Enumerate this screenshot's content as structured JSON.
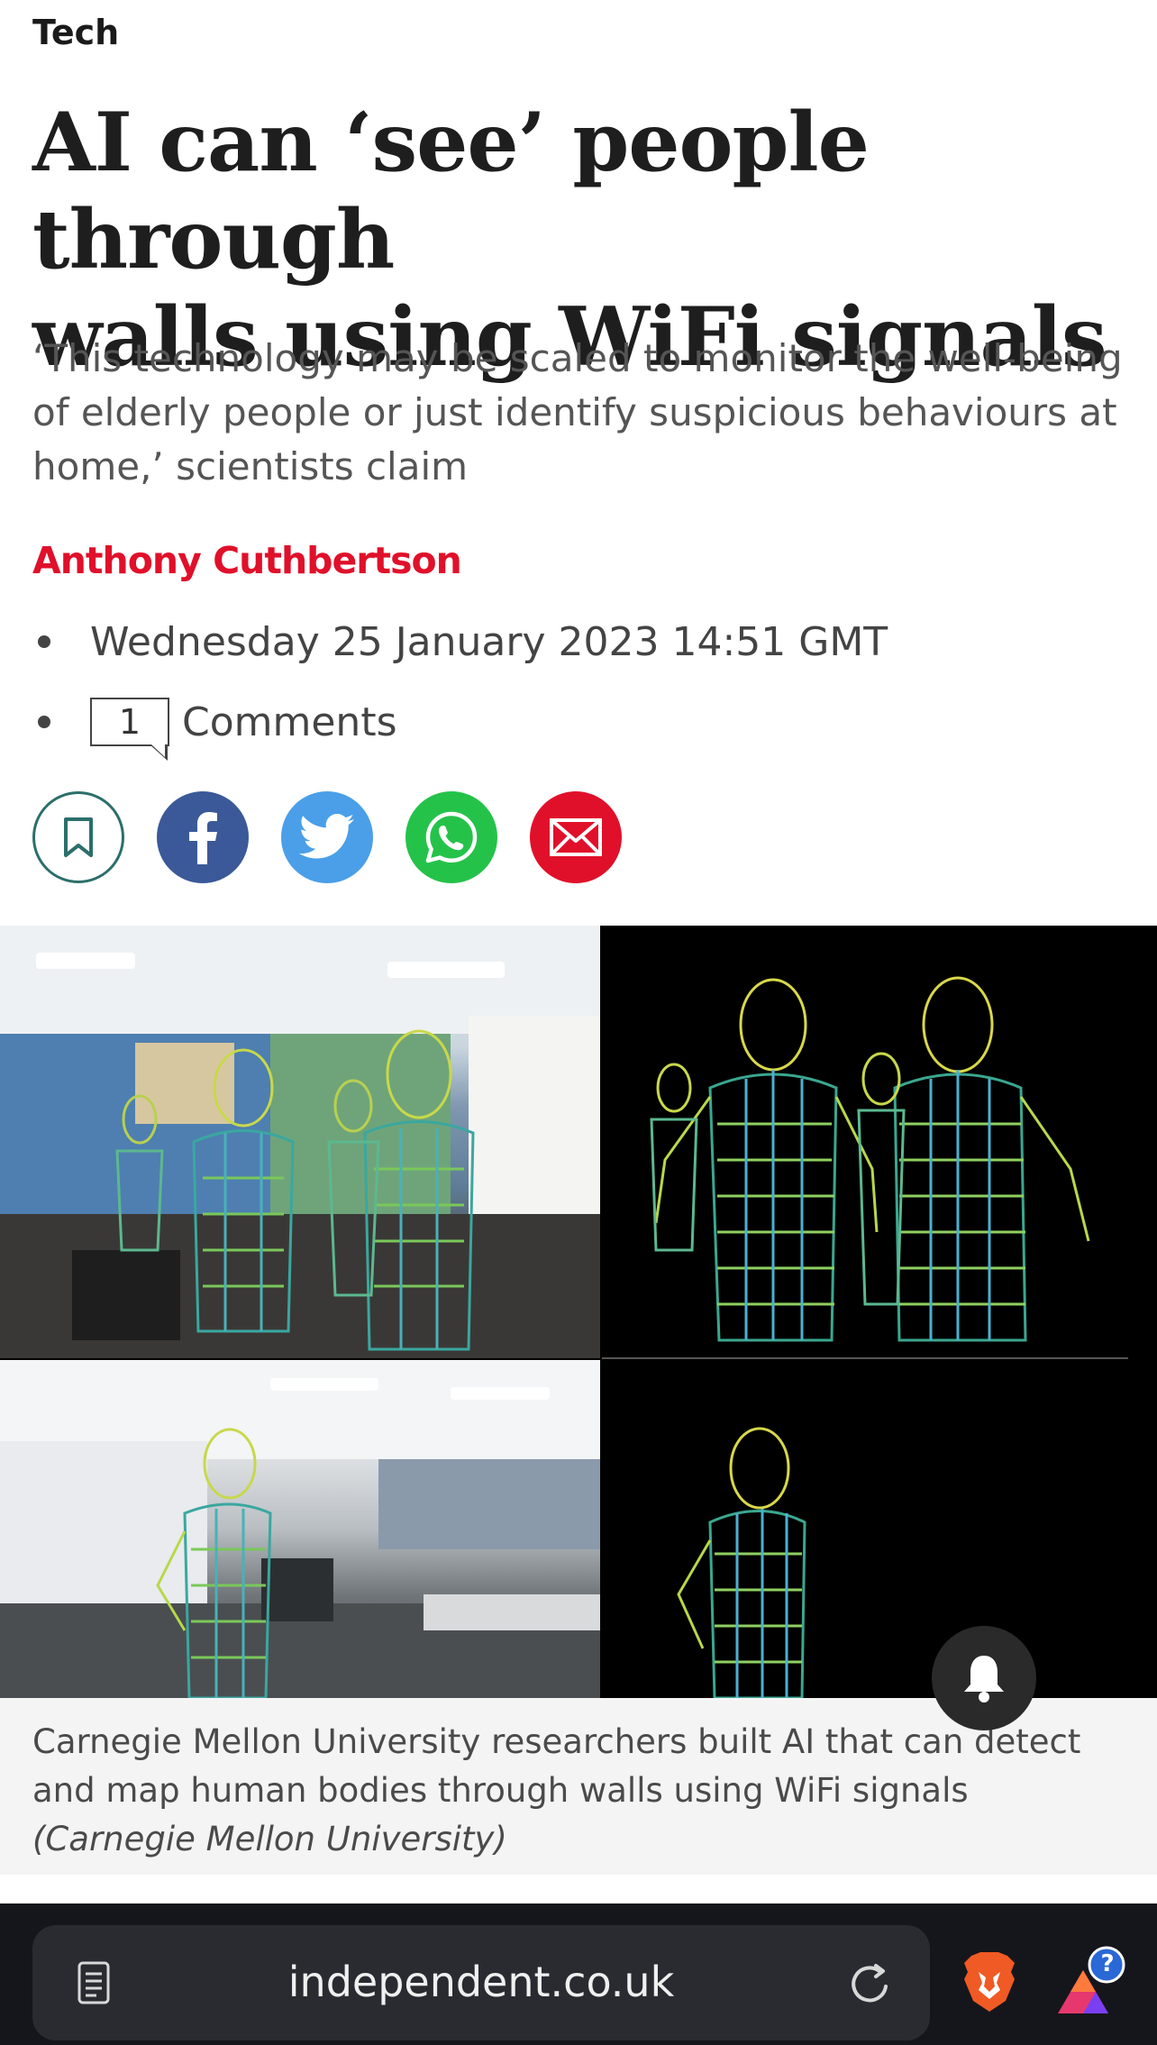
{
  "article": {
    "section": "Tech",
    "headline_line1": "AI can ‘see’ people through",
    "headline_line2": "walls using WiFi signals",
    "standfirst": "‘This technology may be scaled to monitor the well-being of elderly people or just identify suspicious behaviours at home,’ scientists claim",
    "author": "Anthony Cuthbertson",
    "date": "Wednesday 25 January 2023 14:51 GMT",
    "comment_count": "1",
    "comments_label": "Comments"
  },
  "share": {
    "icons": [
      "bookmark-icon",
      "facebook-icon",
      "twitter-icon",
      "whatsapp-icon",
      "email-icon"
    ]
  },
  "image": {
    "caption_text": "Carnegie Mellon University researchers built AI that can detect and map human bodies through walls using WiFi signals ",
    "caption_credit": "(Carnegie Mellon University)"
  },
  "browser": {
    "url": "independent.co.uk",
    "rewards_badge": "?"
  },
  "colors": {
    "accent_red": "#e0102a",
    "facebook": "#3b5998",
    "twitter": "#4a9fe8",
    "whatsapp": "#25c24a",
    "bookmark_teal": "#2b6f6b",
    "browser_bg": "#15161b"
  }
}
